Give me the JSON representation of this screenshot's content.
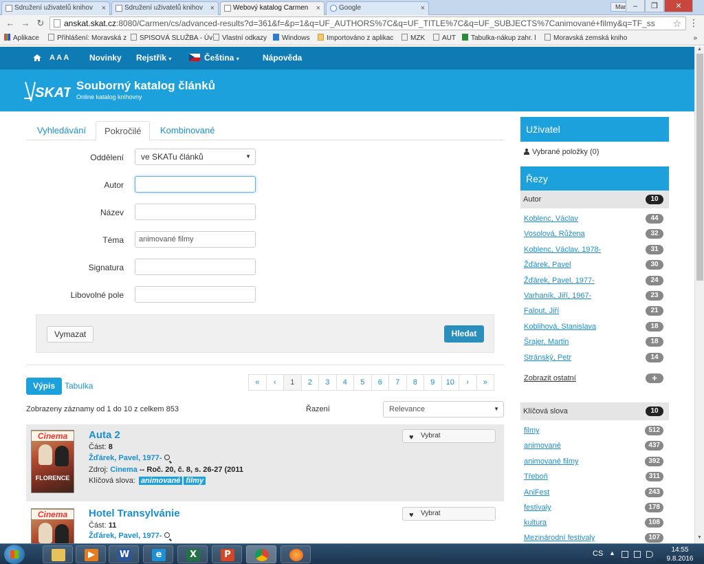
{
  "browser": {
    "tabs": [
      {
        "title": "Sdružení uživatelů knihov"
      },
      {
        "title": "Sdružení uživatelů knihov"
      },
      {
        "title": "Webový katalog Carmen"
      },
      {
        "title": "Google"
      }
    ],
    "user": "Martina",
    "url_host": "anskat.skat.cz",
    "url_rest": ":8080/Carmen/cs/advanced-results?d=361&f=&p=1&q=UF_AUTHORS%7C&q=UF_TITLE%7C&q=UF_SUBJECTS%7Canimované+filmy&q=TF_ss",
    "bookmarks": [
      {
        "label": "Aplikace",
        "icon": "apps-icon"
      },
      {
        "label": "Přihlášení: Moravská z",
        "icon": "page-icon"
      },
      {
        "label": "SPISOVÁ SLUŽBA - Úv",
        "icon": "page-icon"
      },
      {
        "label": "Vlastní odkazy",
        "icon": "page-icon"
      },
      {
        "label": "Windows",
        "icon": "windows-icon"
      },
      {
        "label": "Importováno z aplikac",
        "icon": "folder-icon"
      },
      {
        "label": "MZK",
        "icon": "page-icon"
      },
      {
        "label": "AUT",
        "icon": "page-icon"
      },
      {
        "label": "Tabulka-nákup zahr. l",
        "icon": "sheet-icon"
      },
      {
        "label": "Moravská zemská kniho",
        "icon": "page-icon"
      }
    ],
    "bookmarks_more": "»"
  },
  "nav": {
    "font_size_label": "A A A",
    "news": "Novinky",
    "index": "Rejstřík",
    "language": "Čeština",
    "help": "Nápověda"
  },
  "banner": {
    "logo_text": "SKAT",
    "title": "Souborný katalog článků",
    "subtitle": "Online katalog knihovny"
  },
  "search_tabs": [
    "Vyhledávání",
    "Pokročilé",
    "Kombinované"
  ],
  "form": {
    "department_label": "Oddělení",
    "department_value": "ve SKATu článků",
    "author_label": "Autor",
    "author_value": "",
    "title_label": "Název",
    "title_value": "",
    "topic_label": "Téma",
    "topic_value": "animované filmy",
    "signature_label": "Signatura",
    "signature_value": "",
    "any_label": "Libovolné pole",
    "any_value": "",
    "clear_button": "Vymazat",
    "search_button": "Hledat"
  },
  "results": {
    "view_list": "Výpis",
    "view_table": "Tabulka",
    "pager": [
      "«",
      "‹",
      "1",
      "2",
      "3",
      "4",
      "5",
      "6",
      "7",
      "8",
      "9",
      "10",
      "›",
      "»"
    ],
    "current_page": "1",
    "count_text": "Zobrazeny záznamy od 1 do 10 z celkem 853",
    "sort_label": "Řazení",
    "sort_value": "Relevance",
    "records": [
      {
        "title": "Auta 2",
        "part_label": "Část:",
        "part": "8",
        "author": "Žďárek, Pavel, 1977-",
        "source_label": "Zdroj:",
        "source_link": "Cinema",
        "source_rest": " -- Roč. 20, č. 8, s. 26-27 (2011",
        "kw_label": "Klíčová slova:",
        "keywords": [
          "animované",
          "filmy"
        ],
        "pick": "Vybrat",
        "cover_title": "Cinema",
        "cover_text": "FLORENCE"
      },
      {
        "title": "Hotel Transylvánie",
        "part_label": "Část:",
        "part": "11",
        "author": "Žďárek, Pavel, 1977-",
        "pick": "Vybrat",
        "cover_title": "Cinema"
      }
    ]
  },
  "sidebar": {
    "user_head": "Uživatel",
    "selected": "Vybrané položky (0)",
    "facets_head": "Řezy",
    "author_head": "Autor",
    "author_count": "10",
    "authors": [
      {
        "label": "Koblenc, Václav",
        "count": "44"
      },
      {
        "label": "Vosolová, Růžena",
        "count": "32"
      },
      {
        "label": "Koblenc, Václav, 1978-",
        "count": "31"
      },
      {
        "label": "Žďárek, Pavel",
        "count": "30"
      },
      {
        "label": "Žďárek, Pavel, 1977-",
        "count": "24"
      },
      {
        "label": "Varhaník, Jiří, 1967-",
        "count": "23"
      },
      {
        "label": "Falout, Jiří",
        "count": "21"
      },
      {
        "label": "Koblihová, Stanislava",
        "count": "18"
      },
      {
        "label": "Šrajer, Martin",
        "count": "18"
      },
      {
        "label": "Stránský, Petr",
        "count": "14"
      }
    ],
    "show_more": "Zobrazit ostatní",
    "kw_head": "Klíčová slova",
    "kw_count": "10",
    "keywords": [
      {
        "label": "filmy",
        "count": "512"
      },
      {
        "label": "animované",
        "count": "437"
      },
      {
        "label": "animované filmy",
        "count": "392"
      },
      {
        "label": "Třeboň",
        "count": "311"
      },
      {
        "label": "AniFest",
        "count": "243"
      },
      {
        "label": "festivaly",
        "count": "178"
      },
      {
        "label": "kultura",
        "count": "108"
      },
      {
        "label": "Mezinárodní festivaly",
        "count": "107"
      }
    ]
  },
  "taskbar": {
    "lang": "CS",
    "time": "14:55",
    "date": "9.8.2016"
  },
  "colors": {
    "nav_bg": "#0f7bb5",
    "banner_bg": "#1da1dc",
    "link": "#1a8fcf",
    "search_btn": "#2a8fbd"
  }
}
